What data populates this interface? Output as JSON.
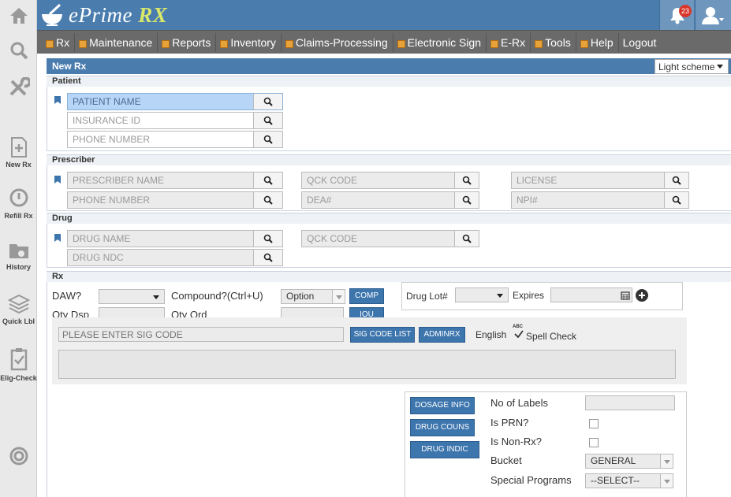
{
  "sidebar": {
    "items": [
      {
        "icon": "home-icon",
        "label": ""
      },
      {
        "icon": "search-icon",
        "label": ""
      },
      {
        "icon": "tools-icon",
        "label": ""
      },
      {
        "icon": "new-rx-icon",
        "label": "New Rx"
      },
      {
        "icon": "refill-rx-icon",
        "label": "Refill Rx"
      },
      {
        "icon": "history-icon",
        "label": "History"
      },
      {
        "icon": "quick-label-icon",
        "label": "Quick Lbl"
      },
      {
        "icon": "elig-check-icon",
        "label": "Elig-Check"
      },
      {
        "icon": "help-ring-icon",
        "label": ""
      }
    ]
  },
  "header": {
    "logo_text": "ePrime",
    "logo_rx": "RX",
    "notification_count": "23"
  },
  "menu": {
    "items": [
      "Rx",
      "Maintenance",
      "Reports",
      "Inventory",
      "Claims-Processing",
      "Electronic Sign",
      "E-Rx",
      "Tools",
      "Help"
    ],
    "logout": "Logout"
  },
  "page": {
    "title": "New Rx",
    "scheme": "Light scheme"
  },
  "patient": {
    "heading": "Patient",
    "name_ph": "PATIENT NAME",
    "insurance_ph": "INSURANCE ID",
    "phone_ph": "PHONE NUMBER"
  },
  "prescriber": {
    "heading": "Prescriber",
    "name_ph": "PRESCRIBER NAME",
    "phone_ph": "PHONE NUMBER",
    "qck_ph": "QCK CODE",
    "dea_ph": "DEA#",
    "license_ph": "LICENSE",
    "npi_ph": "NPI#"
  },
  "drug": {
    "heading": "Drug",
    "name_ph": "DRUG NAME",
    "ndc_ph": "DRUG NDC",
    "qck_ph": "QCK CODE"
  },
  "rx": {
    "heading": "Rx",
    "daw_label": "DAW?",
    "compound_label": "Compound?(Ctrl+U)",
    "compound_value": "Option",
    "comp_btn": "COMP",
    "qty_dsp_label": "Qty Dsp",
    "qty_ord_label": "Qty Ord",
    "iou_btn": "IOU",
    "drug_lot_label": "Drug Lot#",
    "expires_label": "Expires",
    "sig_ph": "PLEASE ENTER SIG CODE",
    "sig_list_btn": "SIG CODE LIST",
    "adminrx_btn": "ADMINRX",
    "language": "English",
    "spell_check": "Spell Check",
    "abc": "ABC"
  },
  "details": {
    "dosage_btn": "DOSAGE INFO",
    "couns_btn": "DRUG COUNS",
    "indic_btn": "DRUG INDIC",
    "labels_label": "No of Labels",
    "prn_label": "Is PRN?",
    "nonrx_label": "Is Non-Rx?",
    "bucket_label": "Bucket",
    "bucket_value": "GENERAL",
    "special_label": "Special Programs",
    "special_value": "--SELECT--"
  },
  "colors": {
    "header_blue": "#4a7dae",
    "menu_gray": "#6a6a6a",
    "button_blue": "#3d75ad",
    "badge_red": "#d9362b"
  }
}
